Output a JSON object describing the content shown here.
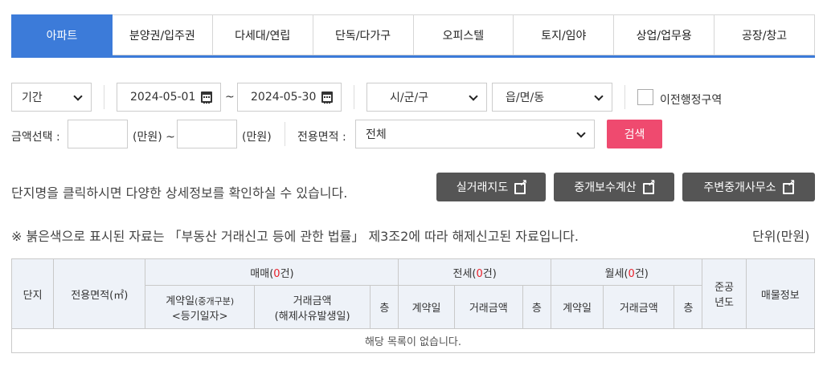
{
  "tabs": [
    {
      "label": "아파트",
      "active": true
    },
    {
      "label": "분양권/입주권",
      "active": false
    },
    {
      "label": "다세대/연립",
      "active": false
    },
    {
      "label": "단독/다가구",
      "active": false
    },
    {
      "label": "오피스텔",
      "active": false
    },
    {
      "label": "토지/임야",
      "active": false
    },
    {
      "label": "상업/업무용",
      "active": false
    },
    {
      "label": "공장/창고",
      "active": false
    }
  ],
  "filters": {
    "period_label": "기간",
    "start_date": "2024-05-01",
    "tilde": "~",
    "end_date": "2024-05-30",
    "sigungu": "시/군/구",
    "eupmyeondong": "읍/면/동",
    "old_district_label": "이전행정구역",
    "price_label": "금액선택 :",
    "unit_man_won": "(만원) ~",
    "unit_man_won2": "(만원)",
    "area_label": "전용면적 :",
    "area_value": "전체",
    "search_button": "검색"
  },
  "info": {
    "hint": "단지명을 클릭하시면 다양한 상세정보를 확인하실 수 있습니다.",
    "notice": "※ 붉은색으로 표시된 자료는 「부동산 거래신고 등에 관한 법률」 제3조2에 따라 해제신고된 자료입니다.",
    "unit": "단위(만원)"
  },
  "buttons": {
    "map": "실거래지도",
    "fee": "중개보수계산",
    "agents": "주변중개사무소"
  },
  "table": {
    "h_danji": "단지",
    "h_area": "전용면적(㎡)",
    "h_sale": "매매(",
    "h_sale_count": "0",
    "h_sale_suffix": "건)",
    "h_jeonse": "전세(",
    "h_jeonse_count": "0",
    "h_jeonse_suffix": "건)",
    "h_wolse": "월세(",
    "h_wolse_count": "0",
    "h_wolse_suffix": "건)",
    "h_built1": "준공",
    "h_built2": "년도",
    "h_listing": "매물정보",
    "h_contract_date": "계약일",
    "h_contract_type": "(중개구분)",
    "h_reg_date": "<등기일자>",
    "h_amount": "거래금액",
    "h_cancel": "(해제사유발생일)",
    "h_floor": "층",
    "h_contract": "계약일",
    "h_amount2": "거래금액",
    "empty": "해당 목록이 없습니다."
  }
}
